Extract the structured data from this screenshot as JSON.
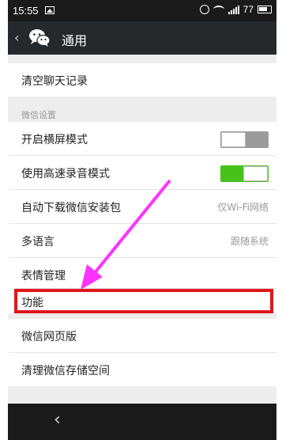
{
  "status_bar": {
    "time": "15:55",
    "battery": "77"
  },
  "title_bar": {
    "back": "‹",
    "title": "通用"
  },
  "rows": {
    "clear_chat": "清空聊天记录",
    "section_wechat_settings": "微信设置",
    "landscape_mode": "开启横屏模式",
    "landscape_mode_on": false,
    "hq_recording": "使用高速录音模式",
    "hq_recording_on": true,
    "auto_download": "自动下载微信安装包",
    "auto_download_value": "仅Wi-Fi网络",
    "language": "多语言",
    "language_value": "跟随系统",
    "sticker_mgmt": "表情管理",
    "features": "功能",
    "web_version": "微信网页版",
    "clean_storage": "清理微信存储空间"
  },
  "nav_bar": {
    "back": "‹"
  },
  "colors": {
    "toggle_on": "#46c21b",
    "highlight_border": "#e0161c",
    "arrow": "#ff33ff"
  }
}
